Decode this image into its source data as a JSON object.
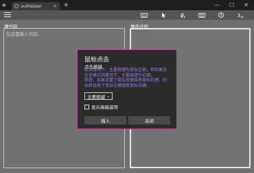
{
  "browser": {
    "tab_title": "auIhelper",
    "new_tab_glyph": "+",
    "tab_close_glyph": "×",
    "window_controls": [
      "—",
      "☐",
      "✕"
    ]
  },
  "appbar": {
    "tools": [
      "keyboard-icon",
      "pointer-icon",
      "touch-icon",
      "keyboard-icon",
      "clock-icon",
      "terminal-icon",
      "more-icon"
    ],
    "more_glyph": "···"
  },
  "source": {
    "label": "源代码",
    "placeholder": "在这里输入代码..."
  },
  "events": {
    "label": "事件过程"
  },
  "dialog": {
    "title": "鼠标点击",
    "subtitle": "点击按键",
    "description_lines": [
      "默认情况下，主要按键为鼠标左键，但如果在",
      "左手模式的情况下，主要按键为右键。",
      "但是，如果设置了鼠标按键或者鼠标右键，则",
      "始终会按下鼠标左键或者鼠标右键。"
    ],
    "select_value": "主要按键",
    "checkbox_label": "显示高级选项",
    "insert_label": "插入",
    "close_label": "关闭"
  },
  "colors": {
    "dialog_border": "#c24aa0",
    "description_text": "#9a7fe6",
    "background": "#6f6f6f"
  }
}
